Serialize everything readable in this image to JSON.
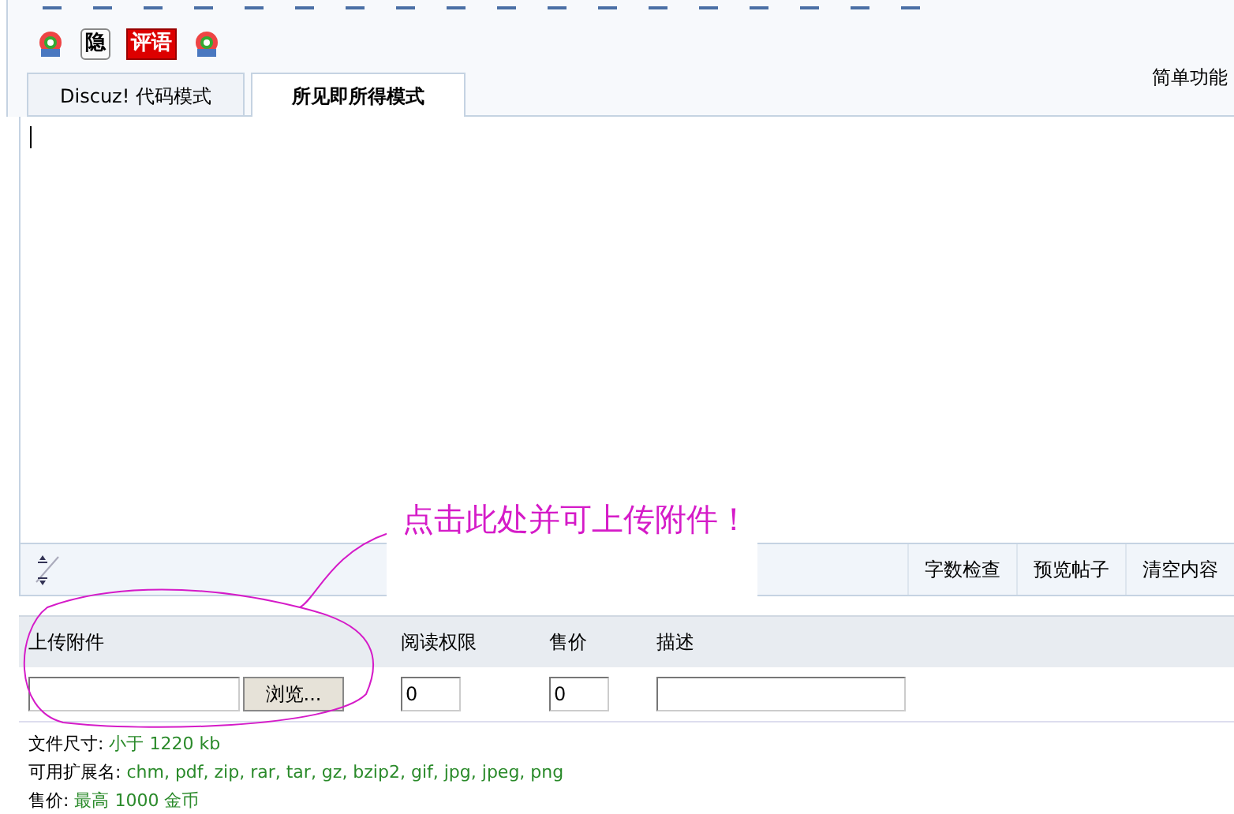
{
  "tabs": [
    {
      "label": "Discuz! 代码模式",
      "selected": false
    },
    {
      "label": "所见即所得模式",
      "selected": true
    }
  ],
  "mode_link": "简单功能",
  "toolbar_badges": [
    {
      "label": "隐",
      "kind": "plain"
    },
    {
      "label": "评语",
      "kind": "red"
    }
  ],
  "editor_actions": [
    "字数检查",
    "预览帖子",
    "清空内容"
  ],
  "upload": {
    "columns": [
      "上传附件",
      "阅读权限",
      "售价",
      "描述"
    ],
    "browse_button": "浏览...",
    "read_permission": "0",
    "price": "0"
  },
  "info": [
    {
      "label": "文件尺寸:",
      "value": "小于  1220 kb"
    },
    {
      "label": "可用扩展名:",
      "value": "chm, pdf, zip, rar, tar, gz, bzip2, gif, jpg, jpeg, png"
    },
    {
      "label": "售价:",
      "value": "最高  1000 金币"
    }
  ],
  "annotation": "点击此处并可上传附件！"
}
